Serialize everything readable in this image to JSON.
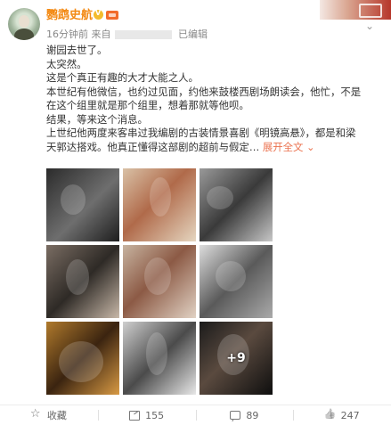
{
  "post": {
    "author": "鹦鹉史航",
    "time": "16分钟前",
    "source_prefix": "来自",
    "edited": "已编辑",
    "lines": [
      "谢园去世了。",
      "太突然。",
      "这是个真正有趣的大才大能之人。",
      "本世纪有他微信，也约过见面，约他来鼓楼西剧场朗读会，他忙，不是",
      "在这个组里就是那个组里，想着那就等他呗。",
      "结果，等来这个消息。",
      "上世纪他两度来客串过我编剧的古装情景喜剧《明镜高悬》，都是和梁",
      "天郭达搭戏。他真正懂得这部剧的超前与假定"
    ],
    "expand": "展开全文",
    "more_images": "+9"
  },
  "images": [
    {
      "icon": "photo"
    },
    {
      "icon": "photo"
    },
    {
      "icon": "photo"
    },
    {
      "icon": "photo"
    },
    {
      "icon": "photo"
    },
    {
      "icon": "photo"
    },
    {
      "icon": "photo"
    },
    {
      "icon": "photo"
    },
    {
      "icon": "photo"
    }
  ],
  "actions": {
    "favorite": "收藏",
    "repost": "155",
    "comment": "89",
    "like": "247"
  },
  "colors": {
    "author": "#f38a14",
    "expand": "#eb7350"
  }
}
